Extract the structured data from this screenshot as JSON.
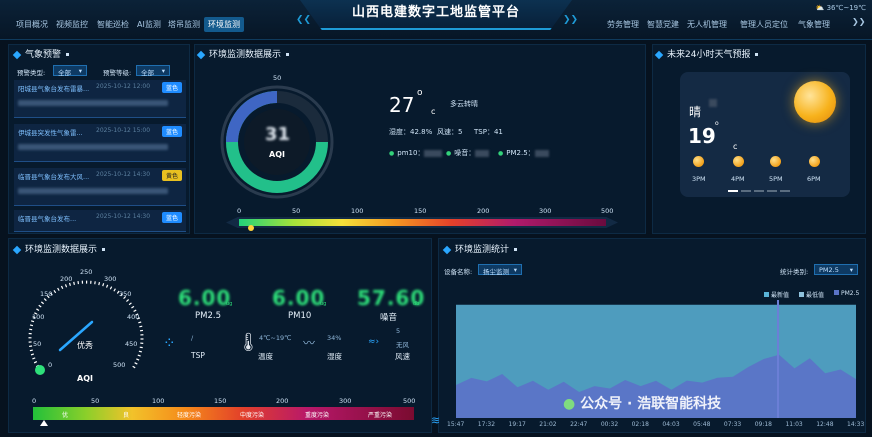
{
  "header": {
    "title": "山西电建数字工地监管平台",
    "nav_left": [
      "项目概况",
      "视频监控",
      "智能巡检",
      "AI监测",
      "塔吊监测",
      "环境监测"
    ],
    "nav_right": [
      "劳务管理",
      "智慧党建",
      "无人机管理",
      "管理人员定位",
      "气象管理"
    ],
    "active": "环境监测",
    "weather_temp": "36℃~19℃"
  },
  "warning_panel": {
    "title": "气象预警",
    "type_label": "预警类型:",
    "type_value": "全部",
    "level_label": "预警等级:",
    "level_value": "全部",
    "items": [
      {
        "title": "阳城县气象台发布雷暴...",
        "time": "2025-10-12 12:00",
        "badge": "蓝色",
        "color": "#1f8cff"
      },
      {
        "title": "伊城县突发性气象雷...",
        "time": "2025-10-12 15:00",
        "badge": "蓝色",
        "color": "#1f8cff"
      },
      {
        "title": "临晋县气象台发布大风...",
        "time": "2025-10-12 14:30",
        "badge": "黄色",
        "color": "#e8c020"
      },
      {
        "title": "临晋县气象台发布...",
        "time": "2025-10-12 14:30",
        "badge": "蓝色",
        "color": "#1f8cff"
      }
    ]
  },
  "aqi_panel": {
    "title": "环境监测数据展示",
    "gauge_top": "50",
    "aqi_value": "31",
    "aqi_label": "AQI",
    "temp": "27",
    "temp_unit": "c",
    "condition": "多云转晴",
    "humidity": "湿度：42.8%",
    "wind": "风速：5",
    "tsp": "TSP：41",
    "pm10_label": "pm10：",
    "noise_label": "噪音：",
    "pm25_label": "PM2.5：",
    "scale": [
      "0",
      "50",
      "100",
      "150",
      "200",
      "300",
      "500"
    ]
  },
  "forecast": {
    "title": "未来24小时天气预报",
    "condition": "晴",
    "temp": "19",
    "unit": "c",
    "times": [
      "3PM",
      "4PM",
      "5PM",
      "6PM"
    ]
  },
  "env_panel": {
    "title": "环境监测数据展示",
    "gauge_ticks": [
      "0",
      "50",
      "100",
      "150",
      "200",
      "250",
      "300",
      "350",
      "400",
      "450",
      "500"
    ],
    "quality": "优秀",
    "aqi_label": "AQI",
    "metrics": [
      {
        "name": "PM2.5",
        "value": "6.00",
        "unit": "ug"
      },
      {
        "name": "PM10",
        "value": "6.00",
        "unit": "ug"
      },
      {
        "name": "噪音",
        "value": "57.60",
        "unit": "db"
      }
    ],
    "sensors": [
      {
        "name": "TSP",
        "value": "/"
      },
      {
        "name": "温度",
        "value": "4℃~19℃"
      },
      {
        "name": "湿度",
        "value": "34%"
      },
      {
        "name": "风速",
        "value": "5",
        "extra": "无风"
      }
    ],
    "scale": [
      "0",
      "50",
      "100",
      "150",
      "200",
      "300",
      "500"
    ],
    "grades": [
      "优",
      "良",
      "轻度污染",
      "中度污染",
      "重度污染",
      "严重污染"
    ]
  },
  "stats_panel": {
    "title": "环境监测统计",
    "device_label": "设备名称:",
    "device_value": "扬尘监测",
    "type_label": "统计类别:",
    "type_value": "PM2.5",
    "legend": [
      "最新值",
      "最低值",
      "PM2.5"
    ],
    "x_ticks": [
      "15:47",
      "17:32",
      "19:17",
      "21:02",
      "22:47",
      "00:32",
      "02:18",
      "04:03",
      "05:48",
      "07:33",
      "09:18",
      "11:03",
      "12:48",
      "14:33"
    ]
  },
  "watermark": "公众号 · 浩联智能科技",
  "chart_data": {
    "type": "area",
    "title": "",
    "xlabel": "",
    "ylabel": "",
    "x": [
      "15:47",
      "17:32",
      "19:17",
      "21:02",
      "22:47",
      "00:32",
      "02:18",
      "04:03",
      "05:48",
      "07:33",
      "09:18",
      "11:03",
      "12:48",
      "14:33"
    ],
    "series": [
      {
        "name": "最新值",
        "color": "#5ab4d8",
        "values": [
          0.96,
          0.96,
          0.96,
          0.96,
          0.96,
          0.96,
          0.96,
          0.96,
          0.96,
          0.96,
          0.96,
          0.96,
          0.96,
          0.96
        ]
      },
      {
        "name": "PM2.5",
        "color": "#5b74c7",
        "values": [
          0.28,
          0.31,
          0.26,
          0.24,
          0.22,
          0.25,
          0.27,
          0.24,
          0.3,
          0.35,
          0.5,
          0.42,
          0.38,
          0.33
        ]
      }
    ]
  }
}
